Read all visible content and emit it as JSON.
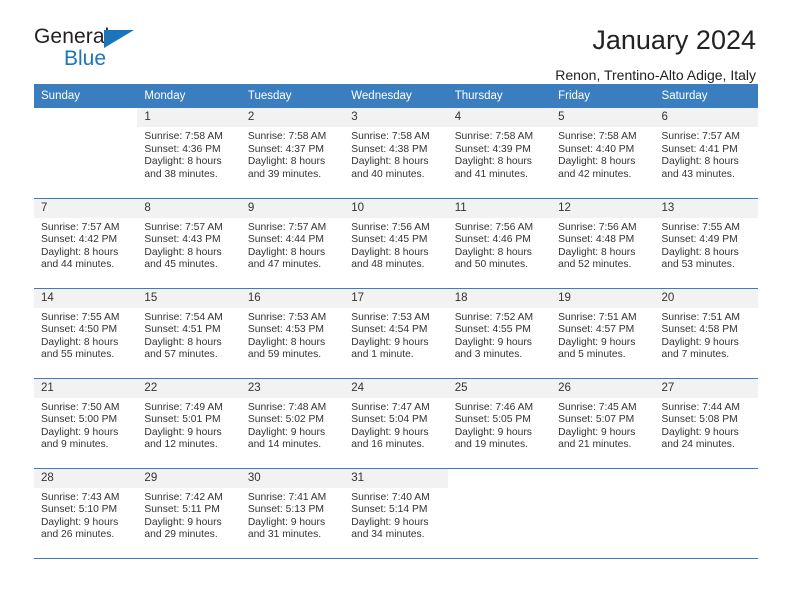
{
  "brand": {
    "line1": "General",
    "line2": "Blue",
    "triangle_color": "#1b75bb"
  },
  "header": {
    "title": "January 2024",
    "subtitle": "Renon, Trentino-Alto Adige, Italy",
    "accent_color": "#3a7ebf",
    "band_color": "#f2f2f2"
  },
  "weekday_headers": [
    "Sunday",
    "Monday",
    "Tuesday",
    "Wednesday",
    "Thursday",
    "Friday",
    "Saturday"
  ],
  "weeks": [
    [
      {
        "day": "",
        "sunrise": "",
        "sunset": "",
        "daylight1": "",
        "daylight2": ""
      },
      {
        "day": "1",
        "sunrise": "Sunrise: 7:58 AM",
        "sunset": "Sunset: 4:36 PM",
        "daylight1": "Daylight: 8 hours",
        "daylight2": "and 38 minutes."
      },
      {
        "day": "2",
        "sunrise": "Sunrise: 7:58 AM",
        "sunset": "Sunset: 4:37 PM",
        "daylight1": "Daylight: 8 hours",
        "daylight2": "and 39 minutes."
      },
      {
        "day": "3",
        "sunrise": "Sunrise: 7:58 AM",
        "sunset": "Sunset: 4:38 PM",
        "daylight1": "Daylight: 8 hours",
        "daylight2": "and 40 minutes."
      },
      {
        "day": "4",
        "sunrise": "Sunrise: 7:58 AM",
        "sunset": "Sunset: 4:39 PM",
        "daylight1": "Daylight: 8 hours",
        "daylight2": "and 41 minutes."
      },
      {
        "day": "5",
        "sunrise": "Sunrise: 7:58 AM",
        "sunset": "Sunset: 4:40 PM",
        "daylight1": "Daylight: 8 hours",
        "daylight2": "and 42 minutes."
      },
      {
        "day": "6",
        "sunrise": "Sunrise: 7:57 AM",
        "sunset": "Sunset: 4:41 PM",
        "daylight1": "Daylight: 8 hours",
        "daylight2": "and 43 minutes."
      }
    ],
    [
      {
        "day": "7",
        "sunrise": "Sunrise: 7:57 AM",
        "sunset": "Sunset: 4:42 PM",
        "daylight1": "Daylight: 8 hours",
        "daylight2": "and 44 minutes."
      },
      {
        "day": "8",
        "sunrise": "Sunrise: 7:57 AM",
        "sunset": "Sunset: 4:43 PM",
        "daylight1": "Daylight: 8 hours",
        "daylight2": "and 45 minutes."
      },
      {
        "day": "9",
        "sunrise": "Sunrise: 7:57 AM",
        "sunset": "Sunset: 4:44 PM",
        "daylight1": "Daylight: 8 hours",
        "daylight2": "and 47 minutes."
      },
      {
        "day": "10",
        "sunrise": "Sunrise: 7:56 AM",
        "sunset": "Sunset: 4:45 PM",
        "daylight1": "Daylight: 8 hours",
        "daylight2": "and 48 minutes."
      },
      {
        "day": "11",
        "sunrise": "Sunrise: 7:56 AM",
        "sunset": "Sunset: 4:46 PM",
        "daylight1": "Daylight: 8 hours",
        "daylight2": "and 50 minutes."
      },
      {
        "day": "12",
        "sunrise": "Sunrise: 7:56 AM",
        "sunset": "Sunset: 4:48 PM",
        "daylight1": "Daylight: 8 hours",
        "daylight2": "and 52 minutes."
      },
      {
        "day": "13",
        "sunrise": "Sunrise: 7:55 AM",
        "sunset": "Sunset: 4:49 PM",
        "daylight1": "Daylight: 8 hours",
        "daylight2": "and 53 minutes."
      }
    ],
    [
      {
        "day": "14",
        "sunrise": "Sunrise: 7:55 AM",
        "sunset": "Sunset: 4:50 PM",
        "daylight1": "Daylight: 8 hours",
        "daylight2": "and 55 minutes."
      },
      {
        "day": "15",
        "sunrise": "Sunrise: 7:54 AM",
        "sunset": "Sunset: 4:51 PM",
        "daylight1": "Daylight: 8 hours",
        "daylight2": "and 57 minutes."
      },
      {
        "day": "16",
        "sunrise": "Sunrise: 7:53 AM",
        "sunset": "Sunset: 4:53 PM",
        "daylight1": "Daylight: 8 hours",
        "daylight2": "and 59 minutes."
      },
      {
        "day": "17",
        "sunrise": "Sunrise: 7:53 AM",
        "sunset": "Sunset: 4:54 PM",
        "daylight1": "Daylight: 9 hours",
        "daylight2": "and 1 minute."
      },
      {
        "day": "18",
        "sunrise": "Sunrise: 7:52 AM",
        "sunset": "Sunset: 4:55 PM",
        "daylight1": "Daylight: 9 hours",
        "daylight2": "and 3 minutes."
      },
      {
        "day": "19",
        "sunrise": "Sunrise: 7:51 AM",
        "sunset": "Sunset: 4:57 PM",
        "daylight1": "Daylight: 9 hours",
        "daylight2": "and 5 minutes."
      },
      {
        "day": "20",
        "sunrise": "Sunrise: 7:51 AM",
        "sunset": "Sunset: 4:58 PM",
        "daylight1": "Daylight: 9 hours",
        "daylight2": "and 7 minutes."
      }
    ],
    [
      {
        "day": "21",
        "sunrise": "Sunrise: 7:50 AM",
        "sunset": "Sunset: 5:00 PM",
        "daylight1": "Daylight: 9 hours",
        "daylight2": "and 9 minutes."
      },
      {
        "day": "22",
        "sunrise": "Sunrise: 7:49 AM",
        "sunset": "Sunset: 5:01 PM",
        "daylight1": "Daylight: 9 hours",
        "daylight2": "and 12 minutes."
      },
      {
        "day": "23",
        "sunrise": "Sunrise: 7:48 AM",
        "sunset": "Sunset: 5:02 PM",
        "daylight1": "Daylight: 9 hours",
        "daylight2": "and 14 minutes."
      },
      {
        "day": "24",
        "sunrise": "Sunrise: 7:47 AM",
        "sunset": "Sunset: 5:04 PM",
        "daylight1": "Daylight: 9 hours",
        "daylight2": "and 16 minutes."
      },
      {
        "day": "25",
        "sunrise": "Sunrise: 7:46 AM",
        "sunset": "Sunset: 5:05 PM",
        "daylight1": "Daylight: 9 hours",
        "daylight2": "and 19 minutes."
      },
      {
        "day": "26",
        "sunrise": "Sunrise: 7:45 AM",
        "sunset": "Sunset: 5:07 PM",
        "daylight1": "Daylight: 9 hours",
        "daylight2": "and 21 minutes."
      },
      {
        "day": "27",
        "sunrise": "Sunrise: 7:44 AM",
        "sunset": "Sunset: 5:08 PM",
        "daylight1": "Daylight: 9 hours",
        "daylight2": "and 24 minutes."
      }
    ],
    [
      {
        "day": "28",
        "sunrise": "Sunrise: 7:43 AM",
        "sunset": "Sunset: 5:10 PM",
        "daylight1": "Daylight: 9 hours",
        "daylight2": "and 26 minutes."
      },
      {
        "day": "29",
        "sunrise": "Sunrise: 7:42 AM",
        "sunset": "Sunset: 5:11 PM",
        "daylight1": "Daylight: 9 hours",
        "daylight2": "and 29 minutes."
      },
      {
        "day": "30",
        "sunrise": "Sunrise: 7:41 AM",
        "sunset": "Sunset: 5:13 PM",
        "daylight1": "Daylight: 9 hours",
        "daylight2": "and 31 minutes."
      },
      {
        "day": "31",
        "sunrise": "Sunrise: 7:40 AM",
        "sunset": "Sunset: 5:14 PM",
        "daylight1": "Daylight: 9 hours",
        "daylight2": "and 34 minutes."
      },
      {
        "day": "",
        "sunrise": "",
        "sunset": "",
        "daylight1": "",
        "daylight2": ""
      },
      {
        "day": "",
        "sunrise": "",
        "sunset": "",
        "daylight1": "",
        "daylight2": ""
      },
      {
        "day": "",
        "sunrise": "",
        "sunset": "",
        "daylight1": "",
        "daylight2": ""
      }
    ]
  ]
}
